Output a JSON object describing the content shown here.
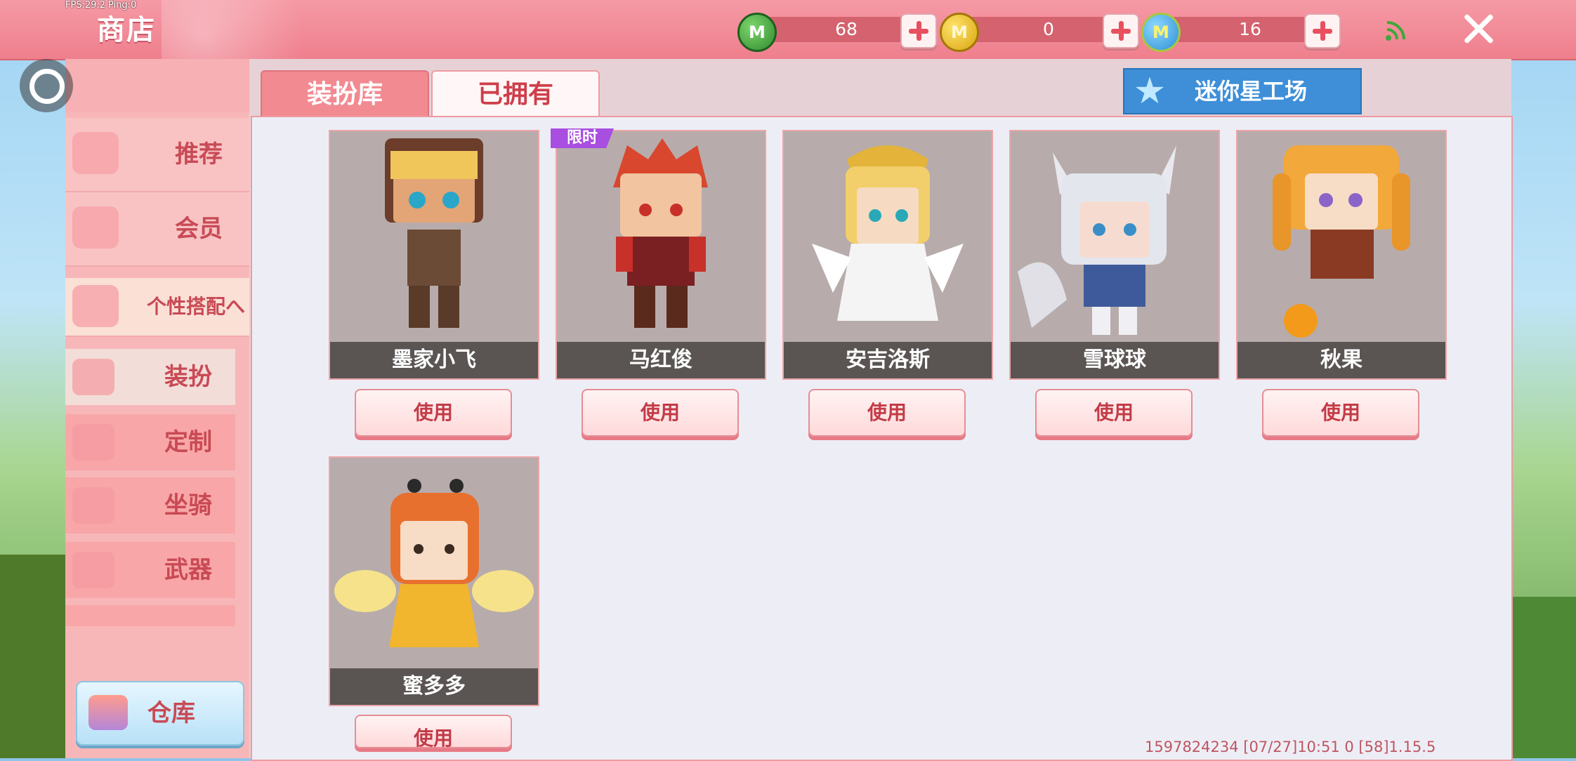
{
  "debug": {
    "fps": "FPS:29.2  Ping:0"
  },
  "header": {
    "title": "商店"
  },
  "currencies": [
    {
      "icon": "green-m-coin-icon",
      "letter": "M",
      "value": "68"
    },
    {
      "icon": "gold-m-coin-icon",
      "letter": "M",
      "value": "0"
    },
    {
      "icon": "blue-m-coin-icon",
      "letter": "M",
      "value": "16"
    }
  ],
  "sidebar": {
    "items": [
      {
        "label": "推荐",
        "icon": "thumbs-up-icon"
      },
      {
        "label": "会员",
        "icon": "vip-card-icon"
      },
      {
        "label": "个性搭配へ",
        "icon": "flower-badge-icon"
      }
    ],
    "subitems": [
      {
        "label": "装扮",
        "icon": "shirt-icon"
      },
      {
        "label": "定制",
        "icon": "pencil-icon"
      },
      {
        "label": "坐骑",
        "icon": "saddle-icon"
      },
      {
        "label": "武器",
        "icon": "gun-icon"
      }
    ],
    "warehouse_label": "仓库"
  },
  "tabs": [
    {
      "label": "装扮库"
    },
    {
      "label": "已拥有"
    }
  ],
  "studio_label": "迷你星工场",
  "limited_tag": "限时",
  "cards": [
    {
      "name": "墨家小飞",
      "button": "使用"
    },
    {
      "name": "马红俊",
      "button": "使用"
    },
    {
      "name": "安吉洛斯",
      "button": "使用"
    },
    {
      "name": "雪球球",
      "button": "使用"
    },
    {
      "name": "秋果",
      "button": "使用"
    },
    {
      "name": "蜜多多",
      "button": "使用"
    }
  ],
  "colors": {
    "accent": "#ef7f8d",
    "button_text": "#c23b47",
    "tag": "#a84ee0"
  },
  "footer": "1597824234   [07/27]10:51 0   [58]1.15.5"
}
